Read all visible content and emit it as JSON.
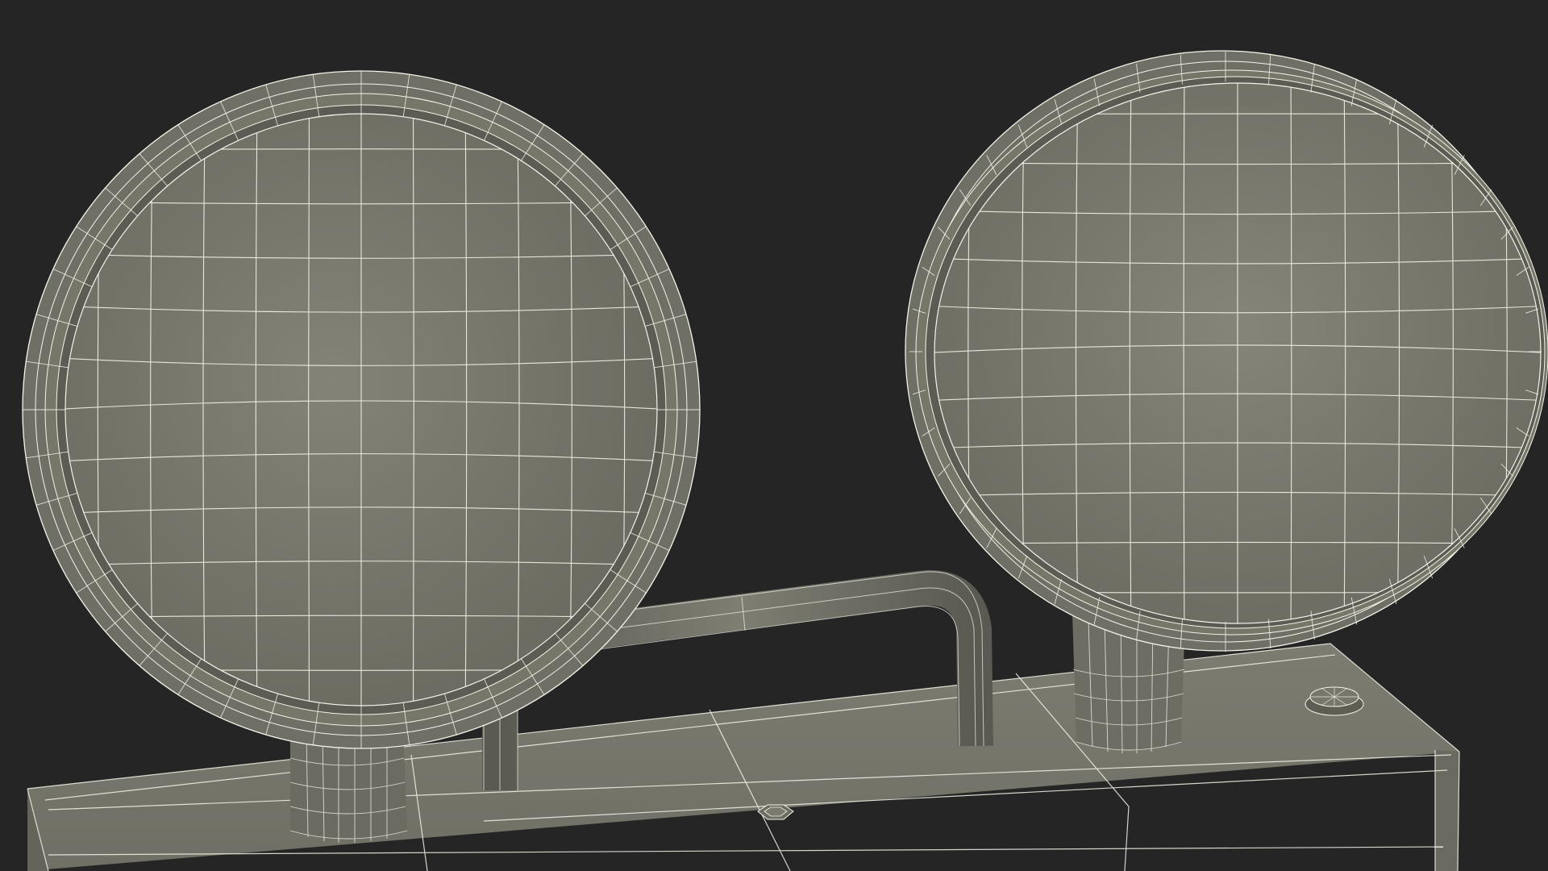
{
  "scene": {
    "subject": "",
    "background_color": "#252525",
    "surface_color": "#7b7b70",
    "surface_shadow_color": "#5e5e56",
    "wire_color": "#f4f4ea",
    "objects": [
      {
        "name": "lamp-head-left",
        "kind": "round-lamp"
      },
      {
        "name": "lamp-head-right",
        "kind": "round-lamp"
      },
      {
        "name": "conduit-pipe",
        "kind": "bent-tube"
      },
      {
        "name": "base-housing",
        "kind": "box"
      },
      {
        "name": "hex-nut",
        "kind": "fastener"
      },
      {
        "name": "round-knob",
        "kind": "fastener"
      }
    ]
  }
}
